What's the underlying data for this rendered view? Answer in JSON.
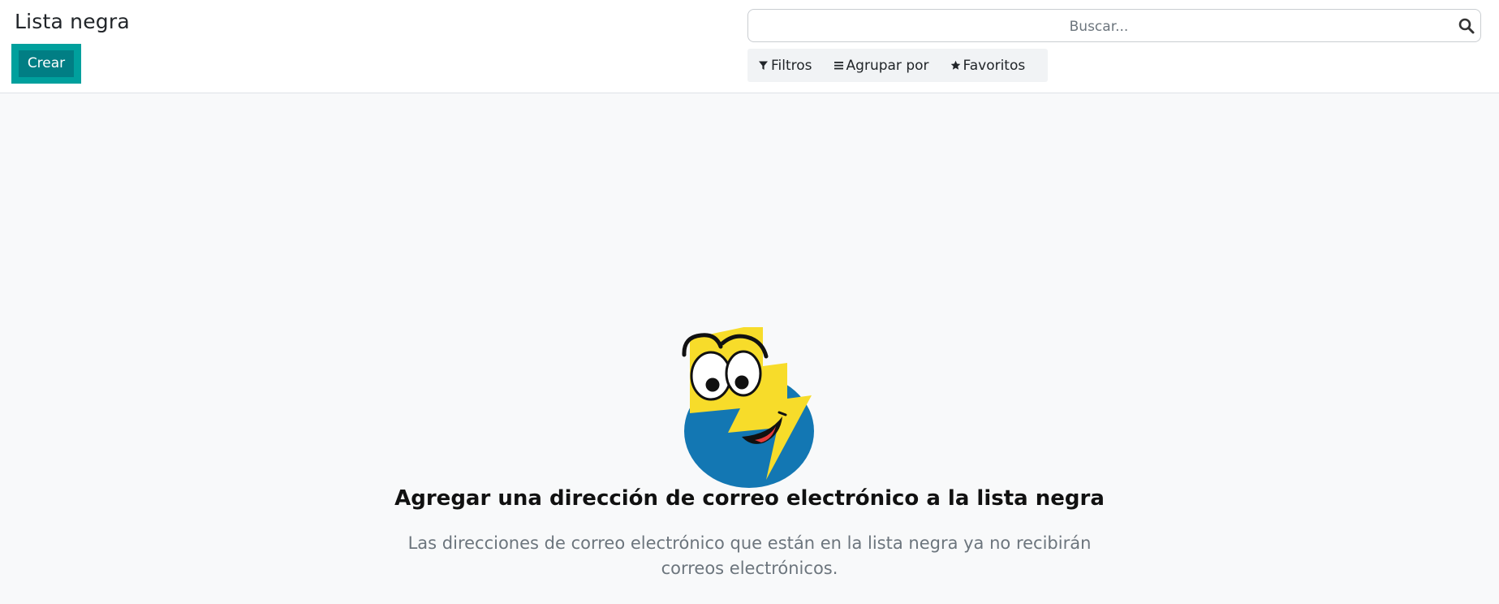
{
  "header": {
    "title": "Lista negra",
    "create_label": "Crear"
  },
  "search": {
    "placeholder": "Buscar..."
  },
  "filters": {
    "filters_label": "Filtros",
    "group_by_label": "Agrupar por",
    "favorites_label": "Favoritos"
  },
  "empty_state": {
    "title": "Agregar una dirección de correo electrónico a la lista negra",
    "description": "Las direcciones de correo electrónico que están en la lista negra ya no recibirán correos electrónicos."
  },
  "icons": {
    "search": "search-icon",
    "filter": "filter-icon",
    "group_by": "bars-icon",
    "favorites": "star-icon",
    "illustration": "smiling-lightning-mascot"
  },
  "colors": {
    "primary": "#017e84",
    "primary_focus_border": "#00a09d",
    "content_bg": "#f8f9fa",
    "mascot_blue": "#1377b3",
    "mascot_yellow": "#f7dc2a"
  }
}
